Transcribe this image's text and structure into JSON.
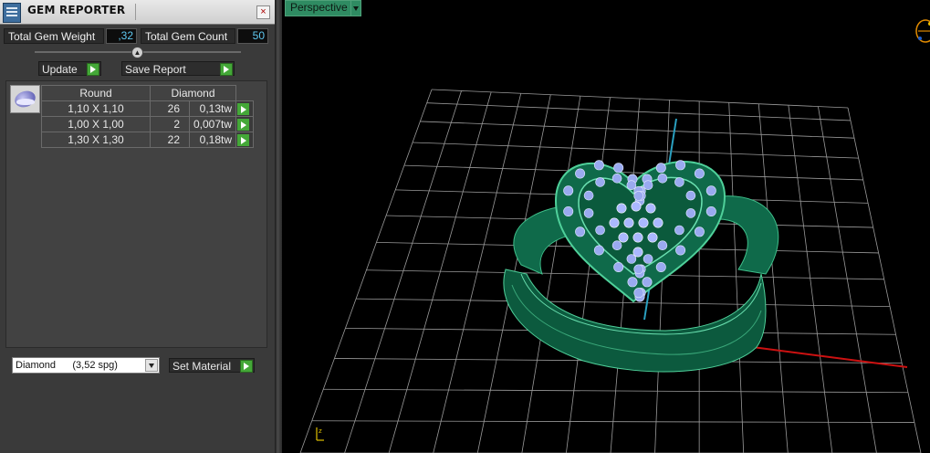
{
  "window": {
    "title": "GEM REPORTER",
    "close_glyph": "×"
  },
  "summary": {
    "total_weight_label": "Total Gem Weight",
    "total_weight_value": ",32",
    "total_count_label": "Total Gem Count",
    "total_count_value": "50"
  },
  "actions": {
    "update_label": "Update",
    "save_report_label": "Save Report"
  },
  "table": {
    "headers": [
      "Round",
      "Diamond"
    ],
    "rows": [
      {
        "size": "1,10 X 1,10",
        "count": "26",
        "weight": "0,13tw"
      },
      {
        "size": "1,00 X 1,00",
        "count": "2",
        "weight": "0,007tw"
      },
      {
        "size": "1,30 X 1,30",
        "count": "22",
        "weight": "0,18tw"
      }
    ]
  },
  "material": {
    "selected": "Diamond      (3,52 spg)",
    "set_label": "Set Material"
  },
  "viewport": {
    "view_name": "Perspective"
  },
  "colors": {
    "ring": "#0f6a4a",
    "grid": "#9a9a9a",
    "stones": "#9aaaf0",
    "axis_x": "#cc1111",
    "axis_y": "#2aa0c0",
    "view_tab": "#2f8b62"
  },
  "icons": [
    "gem-reporter-icon",
    "close-icon",
    "collapse-icon",
    "play-icon",
    "round-diamond-icon",
    "dropdown-arrow-icon",
    "view-cube-icon",
    "axis-gizmo-icon"
  ]
}
